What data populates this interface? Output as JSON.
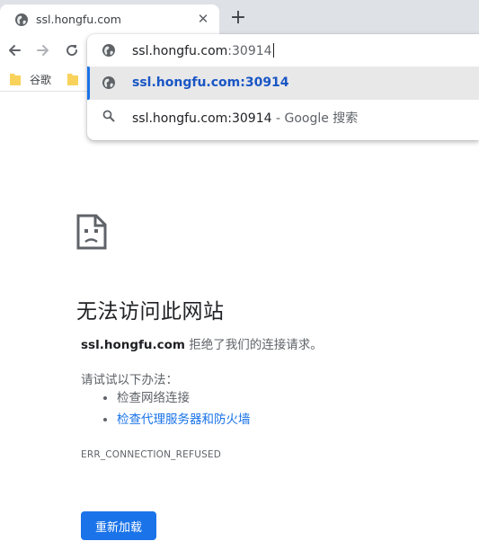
{
  "tab": {
    "title": "ssl.hongfu.com",
    "close_glyph": "✕",
    "new_tab_glyph": "+"
  },
  "bookmarks": [
    {
      "label": "谷歌"
    },
    {
      "label": ""
    }
  ],
  "omnibox": {
    "input_host": "ssl.hongfu.com",
    "input_port": ":30914",
    "suggestions": [
      {
        "text": "ssl.hongfu.com:30914",
        "icon": "globe-icon",
        "selected": true
      },
      {
        "text": "ssl.hongfu.com:30914",
        "separator": " - ",
        "description": "Google 搜索",
        "icon": "search-icon"
      }
    ]
  },
  "error_page": {
    "heading": "无法访问此网站",
    "host": "ssl.hongfu.com",
    "message": " 拒绝了我们的连接请求。",
    "try_label": "请试试以下办法：",
    "suggestions": [
      {
        "text": "检查网络连接",
        "link": false
      },
      {
        "text": "检查代理服务器和防火墙",
        "link": true
      }
    ],
    "error_code": "ERR_CONNECTION_REFUSED",
    "reload_label": "重新加载"
  },
  "colors": {
    "accent": "#1a73e8",
    "tabstrip": "#dee1e6",
    "link": "#1a73e8",
    "selected_row": "#e8e8e9"
  }
}
